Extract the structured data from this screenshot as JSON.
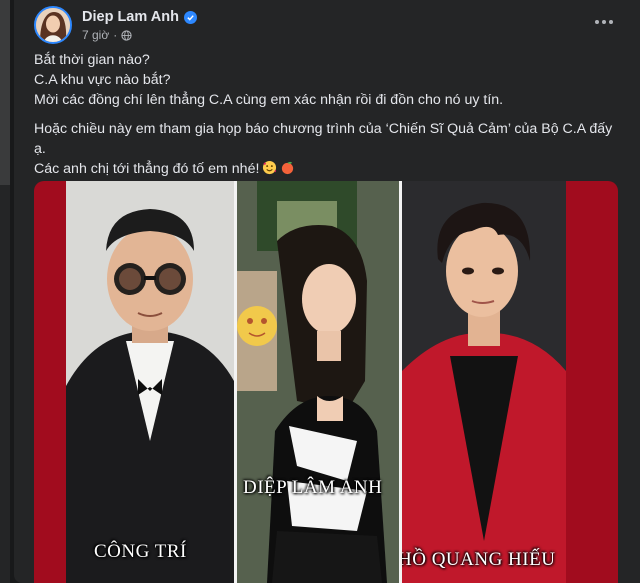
{
  "post": {
    "author": "Diep Lam Anh",
    "time": "7 giờ",
    "text_lines": [
      "Bắt thời gian nào?",
      "C.A khu vực nào bắt?",
      "Mời các đồng chí lên thẳng C.A cùng em xác nhận rồi đi đồn cho nó uy tín."
    ],
    "text_lines2": [
      "Hoặc chiều này em tham gia họp báo chương trình của ‘Chiến Sĩ Quả Cảm’ của Bộ C.A đấy",
      "ạ.",
      "Các anh chị tới thẳng đó tố em nhé!"
    ],
    "emojis": [
      "smiling-face-with-hearts",
      "peach"
    ]
  },
  "media": {
    "captions": [
      "CÔNG TRÍ",
      "DIỆP LÂM ANH",
      "HỒ QUANG HIẾU"
    ]
  },
  "colors": {
    "background": "#18191a",
    "card": "#242526",
    "text": "#e4e6eb",
    "secondary_text": "#b0b3b8",
    "verified_blue": "#2d88ff",
    "collage_red": "#a10c1e"
  }
}
